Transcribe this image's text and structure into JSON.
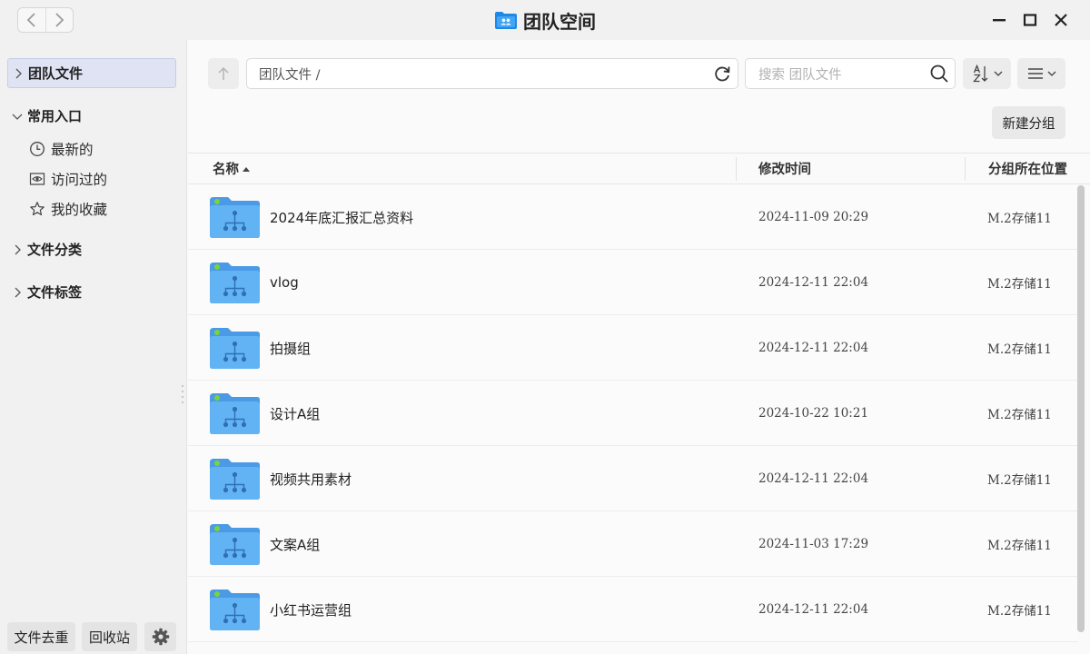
{
  "window": {
    "title": "团队空间"
  },
  "sidebar": {
    "team_files": "团队文件",
    "common_entry": "常用入口",
    "sub_items": [
      {
        "label": "最新的",
        "icon": "clock-icon"
      },
      {
        "label": "访问过的",
        "icon": "eye-icon"
      },
      {
        "label": "我的收藏",
        "icon": "star-icon"
      }
    ],
    "file_category": "文件分类",
    "file_tags": "文件标签",
    "dedupe_button": "文件去重",
    "recycle_button": "回收站"
  },
  "toolbar": {
    "path": "团队文件 /",
    "search_placeholder": "搜索 团队文件",
    "new_group": "新建分组"
  },
  "table": {
    "headers": {
      "name": "名称",
      "modified": "修改时间",
      "location": "分组所在位置"
    },
    "rows": [
      {
        "name": "2024年底汇报汇总资料",
        "modified": "2024-11-09 20:29",
        "location": "M.2存储11"
      },
      {
        "name": "vlog",
        "modified": "2024-12-11 22:04",
        "location": "M.2存储11"
      },
      {
        "name": "拍摄组",
        "modified": "2024-12-11 22:04",
        "location": "M.2存储11"
      },
      {
        "name": "设计A组",
        "modified": "2024-10-22 10:21",
        "location": "M.2存储11"
      },
      {
        "name": "视频共用素材",
        "modified": "2024-12-11 22:04",
        "location": "M.2存储11"
      },
      {
        "name": "文案A组",
        "modified": "2024-11-03 17:29",
        "location": "M.2存储11"
      },
      {
        "name": "小红书运营组",
        "modified": "2024-12-11 22:04",
        "location": "M.2存储11"
      }
    ]
  },
  "colors": {
    "accent": "#4a90e2",
    "folder": "#5aa8ef",
    "active_bg": "#dfe3f3",
    "status_dot": "#7bd23a"
  }
}
